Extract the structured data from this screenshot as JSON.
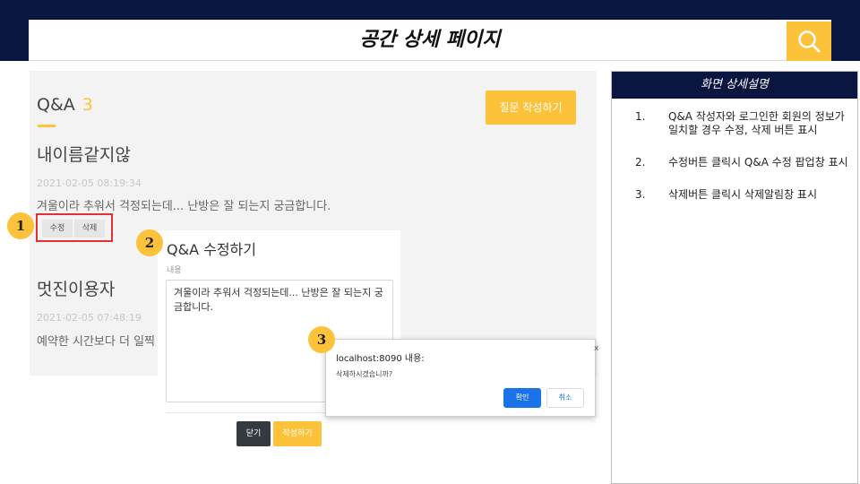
{
  "header": {
    "title": "공간 상세 페이지",
    "search_icon": "search-icon",
    "search_color": "#fcc23a"
  },
  "qa": {
    "label": "Q&A",
    "count": "3",
    "ask_button": "질문 작성하기",
    "questions": [
      {
        "title": "내이름같지않",
        "date": "2021-02-05 08:19:34",
        "body": "겨울이라 추워서 걱정되는데... 난방은 잘 되는지 궁금합니다.",
        "edit_label": "수정",
        "delete_label": "삭제"
      },
      {
        "title": "멋진이용자",
        "date": "2021-02-05 07:48:19",
        "body": "예약한 시간보다 더 일찍"
      }
    ]
  },
  "edit_modal": {
    "title": "Q&A 수정하기",
    "content_label": "내용",
    "content_value": "겨울이라 추워서 걱정되는데... 난방은 잘 되는지 궁금합니다.",
    "close_label": "닫기",
    "submit_label": "작성하기"
  },
  "confirm_dialog": {
    "title": "localhost:8090 내용:",
    "message": "삭제하시겠습니까?",
    "ok_label": "확인",
    "cancel_label": "취소",
    "edge_mark": "x"
  },
  "badges": [
    "1",
    "2",
    "3"
  ],
  "description": {
    "heading": "화면 상세설명",
    "items": [
      {
        "num": "1.",
        "text": "Q&A 작성자와 로그인한 회원의 정보가 일치할 경우 수정, 삭제 버튼 표시"
      },
      {
        "num": "2.",
        "text": "수정버튼 클릭시 Q&A 수정 팝업창 표시"
      },
      {
        "num": "3.",
        "text": "삭제버튼 클릭시 삭제알림창 표시"
      }
    ]
  },
  "colors": {
    "navy": "#0b1640",
    "accent": "#fcc23a",
    "highlight_border": "#e43030",
    "dialog_primary": "#1a73e8"
  }
}
